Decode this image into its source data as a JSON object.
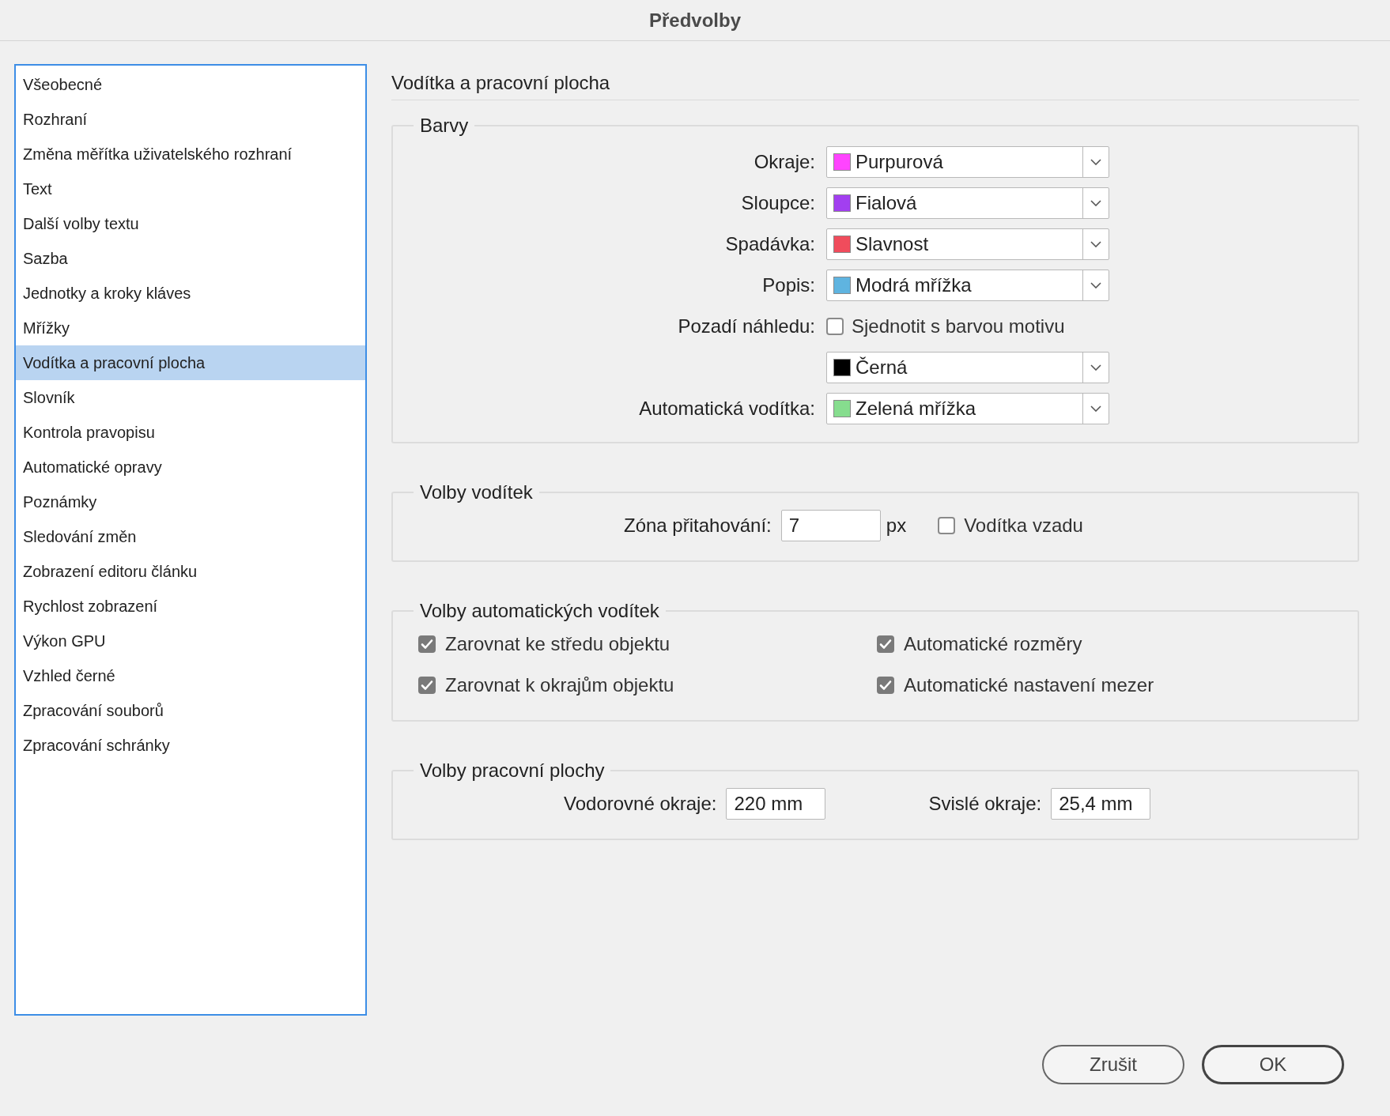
{
  "window": {
    "title": "Předvolby"
  },
  "sidebar": {
    "items": [
      {
        "label": "Všeobecné",
        "selected": false
      },
      {
        "label": "Rozhraní",
        "selected": false
      },
      {
        "label": "Změna měřítka uživatelského rozhraní",
        "selected": false
      },
      {
        "label": "Text",
        "selected": false
      },
      {
        "label": "Další volby textu",
        "selected": false
      },
      {
        "label": "Sazba",
        "selected": false
      },
      {
        "label": "Jednotky a kroky kláves",
        "selected": false
      },
      {
        "label": "Mřížky",
        "selected": false
      },
      {
        "label": "Vodítka a pracovní plocha",
        "selected": true
      },
      {
        "label": "Slovník",
        "selected": false
      },
      {
        "label": "Kontrola pravopisu",
        "selected": false
      },
      {
        "label": "Automatické opravy",
        "selected": false
      },
      {
        "label": "Poznámky",
        "selected": false
      },
      {
        "label": "Sledování změn",
        "selected": false
      },
      {
        "label": "Zobrazení editoru článku",
        "selected": false
      },
      {
        "label": "Rychlost zobrazení",
        "selected": false
      },
      {
        "label": "Výkon GPU",
        "selected": false
      },
      {
        "label": "Vzhled černé",
        "selected": false
      },
      {
        "label": "Zpracování souborů",
        "selected": false
      },
      {
        "label": "Zpracování schránky",
        "selected": false
      }
    ]
  },
  "panel": {
    "title": "Vodítka a pracovní plocha",
    "colors": {
      "title": "Barvy",
      "rows": [
        {
          "kind": "dropdown",
          "label": "Okraje:",
          "value": "Purpurová",
          "color": "#ff44ff"
        },
        {
          "kind": "dropdown",
          "label": "Sloupce:",
          "value": "Fialová",
          "color": "#a23ff0"
        },
        {
          "kind": "dropdown",
          "label": "Spadávka:",
          "value": "Slavnost",
          "color": "#f04c5c"
        },
        {
          "kind": "dropdown",
          "label": "Popis:",
          "value": "Modrá mřížka",
          "color": "#5fb4e0"
        },
        {
          "kind": "checkbox",
          "label": "Pozadí náhledu:",
          "text": "Sjednotit s barvou motivu",
          "checked": false
        },
        {
          "kind": "dropdown",
          "value": "Černá",
          "color": "#000000"
        },
        {
          "kind": "dropdown",
          "label": "Automatická vodítka:",
          "value": "Zelená mřížka",
          "color": "#86dd8e"
        }
      ]
    },
    "guides": {
      "title": "Volby vodítek",
      "snap_label": "Zóna přitahování:",
      "snap_value": "7",
      "unit": "px",
      "behind": {
        "label": "Vodítka vzadu",
        "checked": false
      }
    },
    "smart_guides": {
      "title": "Volby automatických vodítek",
      "options": [
        {
          "label": "Zarovnat ke středu objektu",
          "checked": true
        },
        {
          "label": "Automatické rozměry",
          "checked": true
        },
        {
          "label": "Zarovnat k okrajům objektu",
          "checked": true
        },
        {
          "label": "Automatické nastavení mezer",
          "checked": true
        }
      ]
    },
    "pasteboard": {
      "title": "Volby pracovní plochy",
      "fields": [
        {
          "label": "Vodorovné okraje:",
          "value": "220 mm"
        },
        {
          "label": "Svislé okraje:",
          "value": "25,4 mm"
        }
      ]
    }
  },
  "buttons": [
    {
      "label": "Zrušit",
      "default": false
    },
    {
      "label": "OK",
      "default": true
    }
  ]
}
